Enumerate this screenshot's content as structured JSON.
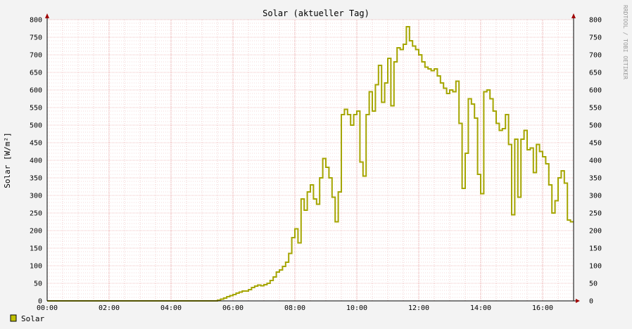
{
  "chart_data": {
    "type": "line",
    "title": "Solar (aktueller Tag)",
    "ylabel": "Solar [W/m²]",
    "xlabel": "",
    "watermark": "RRDTOOL / TOBI OETIKER",
    "xlim": [
      0,
      17
    ],
    "ylim": [
      0,
      800
    ],
    "x_ticks": [
      "00:00",
      "02:00",
      "04:00",
      "06:00",
      "08:00",
      "10:00",
      "12:00",
      "14:00",
      "16:00"
    ],
    "y_ticks": [
      "0",
      "50",
      "100",
      "150",
      "200",
      "250",
      "300",
      "350",
      "400",
      "450",
      "500",
      "550",
      "600",
      "650",
      "700",
      "750",
      "800"
    ],
    "legend_position": "bottom-left",
    "colors": {
      "series": "#c0c000",
      "series_outline": "#a5a500",
      "grid_minor": "#e9b1b1",
      "axis": "#a00000"
    },
    "series": [
      {
        "name": "Solar",
        "step": true,
        "x": [
          0,
          5.5,
          5.6,
          5.7,
          5.8,
          5.9,
          6.0,
          6.1,
          6.2,
          6.3,
          6.4,
          6.5,
          6.6,
          6.7,
          6.8,
          6.9,
          7.0,
          7.1,
          7.2,
          7.3,
          7.4,
          7.5,
          7.6,
          7.7,
          7.8,
          7.9,
          8.0,
          8.1,
          8.2,
          8.3,
          8.4,
          8.5,
          8.6,
          8.7,
          8.8,
          8.9,
          9.0,
          9.1,
          9.2,
          9.3,
          9.4,
          9.5,
          9.6,
          9.7,
          9.8,
          9.9,
          10.0,
          10.1,
          10.2,
          10.3,
          10.4,
          10.5,
          10.6,
          10.7,
          10.8,
          10.9,
          11.0,
          11.1,
          11.2,
          11.3,
          11.4,
          11.5,
          11.6,
          11.7,
          11.8,
          11.9,
          12.0,
          12.1,
          12.2,
          12.3,
          12.4,
          12.5,
          12.6,
          12.7,
          12.8,
          12.9,
          13.0,
          13.1,
          13.2,
          13.3,
          13.4,
          13.5,
          13.6,
          13.7,
          13.8,
          13.9,
          14.0,
          14.1,
          14.2,
          14.3,
          14.4,
          14.5,
          14.6,
          14.7,
          14.8,
          14.9,
          15.0,
          15.1,
          15.2,
          15.3,
          15.4,
          15.5,
          15.6,
          15.7,
          15.8,
          15.9,
          16.0,
          16.1,
          16.2,
          16.3,
          16.4,
          16.5,
          16.6,
          16.7,
          16.8,
          16.9
        ],
        "values": [
          0,
          2,
          5,
          8,
          12,
          15,
          18,
          22,
          25,
          28,
          28,
          32,
          38,
          42,
          45,
          43,
          46,
          50,
          58,
          68,
          82,
          88,
          98,
          110,
          135,
          180,
          205,
          165,
          290,
          258,
          310,
          330,
          290,
          275,
          350,
          405,
          380,
          350,
          295,
          225,
          310,
          530,
          545,
          530,
          500,
          530,
          540,
          395,
          355,
          530,
          595,
          540,
          615,
          670,
          565,
          620,
          690,
          555,
          680,
          720,
          715,
          730,
          780,
          740,
          725,
          715,
          700,
          680,
          665,
          660,
          655,
          660,
          640,
          620,
          605,
          590,
          600,
          595,
          625,
          505,
          320,
          420,
          575,
          560,
          520,
          360,
          305,
          595,
          600,
          575,
          540,
          505,
          485,
          490,
          530,
          445,
          245,
          460,
          295,
          460,
          485,
          430,
          435,
          365,
          445,
          425,
          410,
          390,
          330,
          250,
          285,
          350,
          370,
          335,
          230,
          225
        ]
      }
    ]
  }
}
